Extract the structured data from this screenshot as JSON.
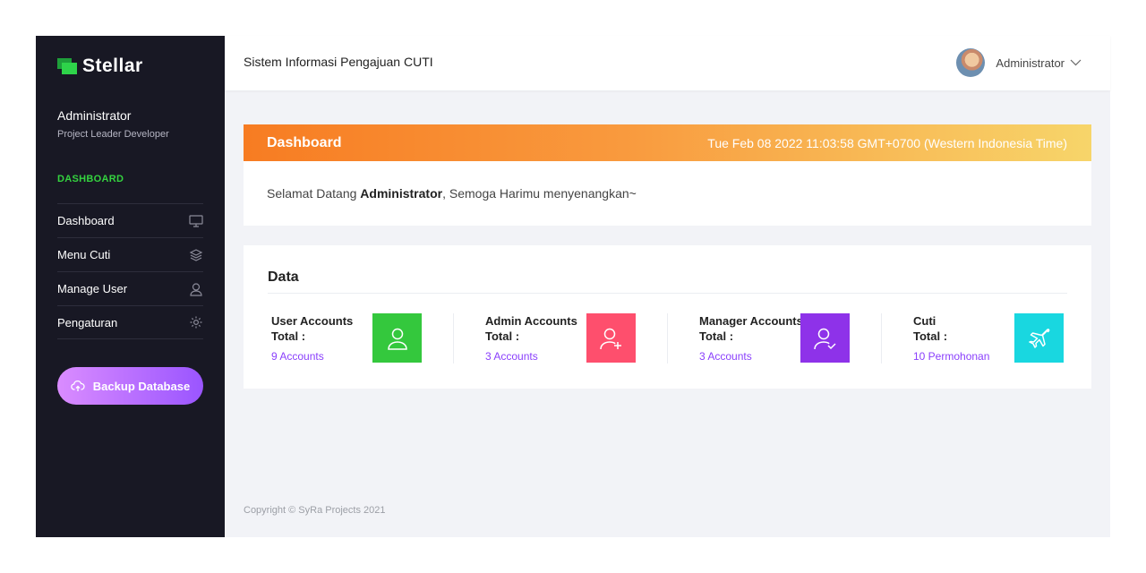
{
  "brand": {
    "name": "Stellar"
  },
  "profile": {
    "name": "Administrator",
    "role": "Project Leader Developer"
  },
  "sidebar": {
    "section_label": "DASHBOARD",
    "items": [
      {
        "label": "Dashboard",
        "icon": "monitor-icon"
      },
      {
        "label": "Menu Cuti",
        "icon": "layers-icon"
      },
      {
        "label": "Manage User",
        "icon": "user-icon"
      },
      {
        "label": "Pengaturan",
        "icon": "gear-icon"
      }
    ],
    "backup_button": {
      "label": "Backup Database",
      "icon": "cloud-upload-icon"
    }
  },
  "topbar": {
    "title": "Sistem Informasi Pengajuan CUTI",
    "user_name": "Administrator"
  },
  "dashboard": {
    "title": "Dashboard",
    "datetime": "Tue Feb 08 2022 11:03:58 GMT+0700 (Western Indonesia Time)",
    "welcome_prefix": "Selamat Datang ",
    "welcome_name": "Administrator",
    "welcome_suffix": ", Semoga Harimu menyenangkan~"
  },
  "data_section": {
    "title": "Data",
    "stats": [
      {
        "title": "User Accounts",
        "total_label": "Total :",
        "value": "9 Accounts",
        "color": "#34c83d",
        "icon": "user-icon"
      },
      {
        "title": "Admin Accounts",
        "total_label": "Total :",
        "value": "3 Accounts",
        "color": "#fe4f6d",
        "icon": "user-plus-icon"
      },
      {
        "title": "Manager Accounts",
        "total_label": "Total :",
        "value": "3 Accounts",
        "color": "#8e32e9",
        "icon": "user-check-icon"
      },
      {
        "title": "Cuti",
        "total_label": "Total :",
        "value": "10 Permohonan",
        "color": "#19d7e0",
        "icon": "plane-icon"
      }
    ]
  },
  "footer": {
    "copyright": "Copyright © SyRa Projects 2021"
  },
  "colors": {
    "sidebar_bg": "#181824",
    "accent_green": "#34d33f",
    "link_purple": "#8a3ffc"
  }
}
